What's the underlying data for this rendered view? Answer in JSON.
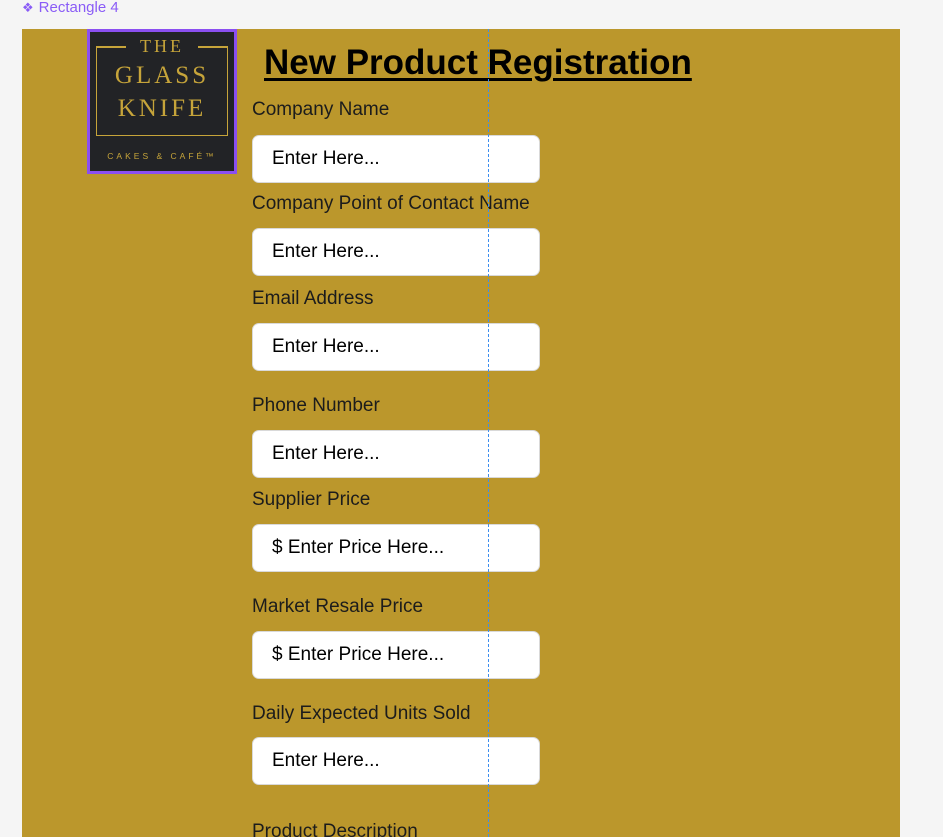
{
  "canvas": {
    "frame_label": "Rectangle 4"
  },
  "logo": {
    "line1": "THE",
    "line2": "GLASS",
    "line3": "KNIFE",
    "tagline": "CAKES & CAFÉ™"
  },
  "form": {
    "title": "New Product Registration",
    "fields": [
      {
        "label": "Company Name",
        "placeholder": "Enter Here..."
      },
      {
        "label": "Company Point of Contact Name",
        "placeholder": "Enter Here..."
      },
      {
        "label": "Email Address",
        "placeholder": "Enter Here..."
      },
      {
        "label": "Phone Number",
        "placeholder": "Enter Here..."
      },
      {
        "label": "Supplier Price",
        "placeholder": "$ Enter Price Here..."
      },
      {
        "label": "Market Resale Price",
        "placeholder": "$ Enter Price Here..."
      },
      {
        "label": "Daily Expected Units Sold",
        "placeholder": "Enter Here..."
      },
      {
        "label": "Product Description"
      }
    ]
  },
  "colors": {
    "background": "#bb972c",
    "selection": "#8b4ff0",
    "guide": "#3d8ef0"
  }
}
